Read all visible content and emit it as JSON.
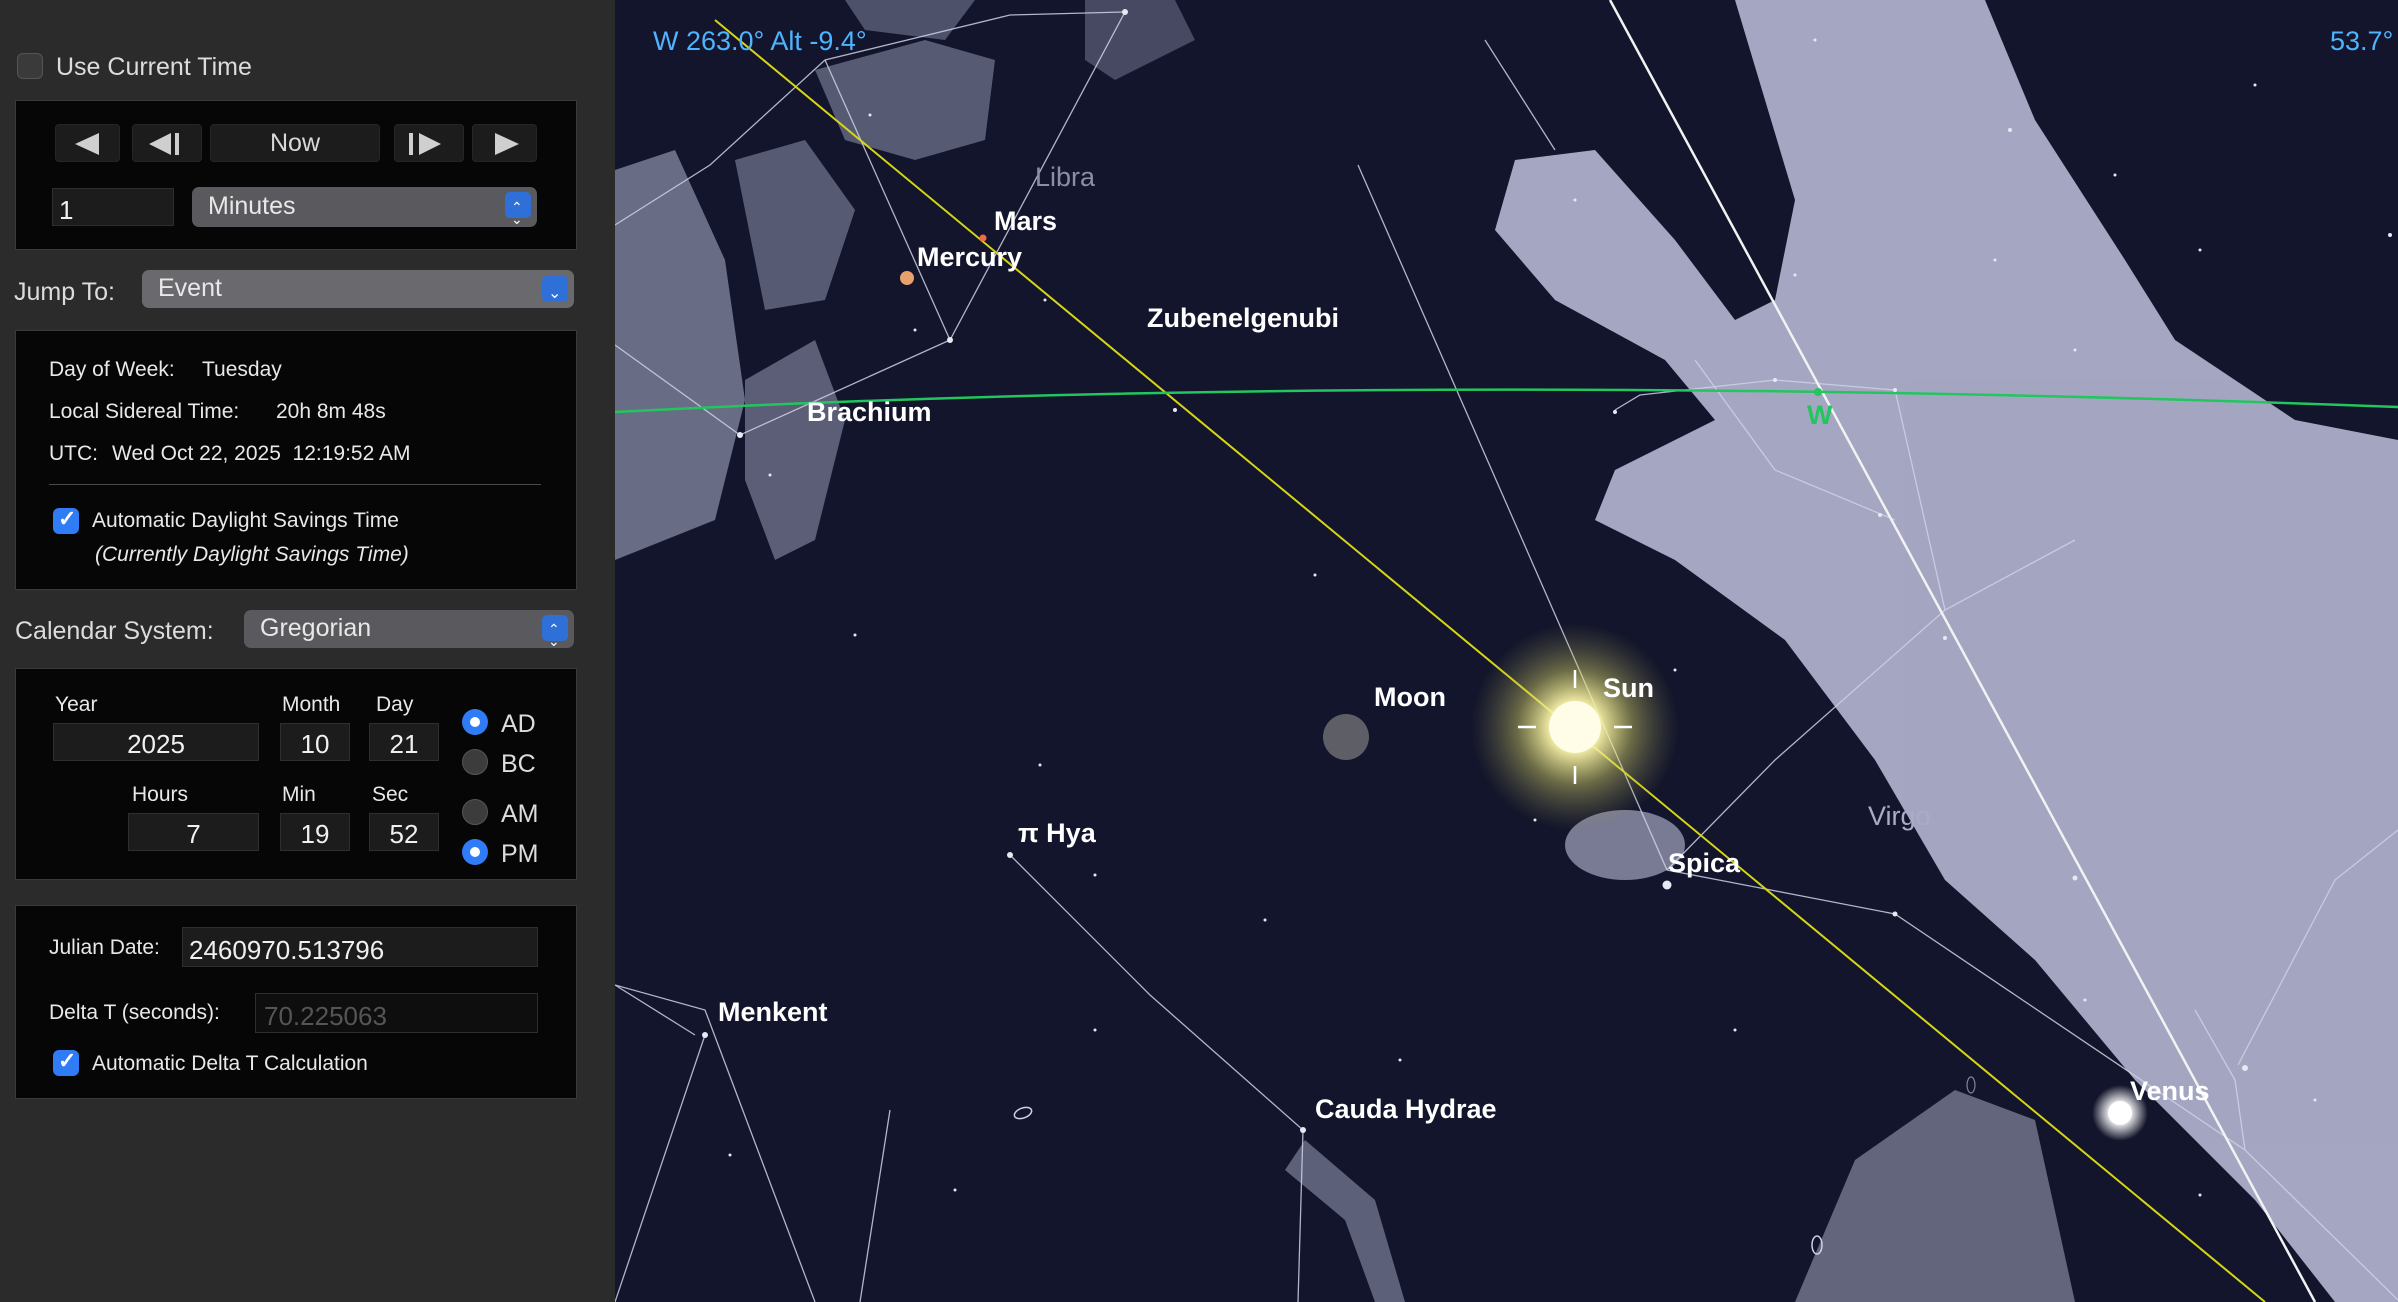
{
  "panel": {
    "use_current_time": "Use Current Time",
    "nav": {
      "now": "Now",
      "step_value": "1",
      "step_unit": "Minutes"
    },
    "jump_to": {
      "label": "Jump To:",
      "value": "Event"
    },
    "info": {
      "day_of_week_label": "Day of Week:",
      "day_of_week": "Tuesday",
      "lst_label": "Local Sidereal Time:",
      "lst": "20h 8m 48s",
      "utc_label": "UTC:",
      "utc": "Wed Oct 22, 2025  12:19:52 AM",
      "auto_dst": "Automatic Daylight Savings Time",
      "dst_status": "(Currently Daylight Savings Time)"
    },
    "calendar": {
      "label": "Calendar System:",
      "value": "Gregorian"
    },
    "date": {
      "year_label": "Year",
      "year": "2025",
      "month_label": "Month",
      "month": "10",
      "day_label": "Day",
      "day": "21",
      "hours_label": "Hours",
      "hours": "7",
      "min_label": "Min",
      "min": "19",
      "sec_label": "Sec",
      "sec": "52",
      "ad": "AD",
      "bc": "BC",
      "am": "AM",
      "pm": "PM"
    },
    "julian": {
      "label": "Julian Date:",
      "value": "2460970.513796",
      "delta_label": "Delta T (seconds):",
      "delta_value": "70.225063",
      "auto_delta": "Automatic Delta T Calculation"
    }
  },
  "sky": {
    "readout": "W 263.0° Alt -9.4°",
    "readout_right": "53.7°",
    "labels": {
      "libra": "Libra",
      "mars": "Mars",
      "mercury": "Mercury",
      "zubenelgenubi": "Zubenelgenubi",
      "brachium": "Brachium",
      "w": "W",
      "moon": "Moon",
      "sun": "Sun",
      "pi_hya": "π Hya",
      "spica": "Spica",
      "virgo": "Virgo",
      "menkent": "Menkent",
      "cauda_hydrae": "Cauda Hydrae",
      "venus": "Venus"
    }
  },
  "colors": {
    "accent": "#2f7cf6",
    "horizon": "#22c55e",
    "ecliptic": "#d6d615",
    "readout": "#4fb3ff",
    "sky": "#12152b"
  }
}
